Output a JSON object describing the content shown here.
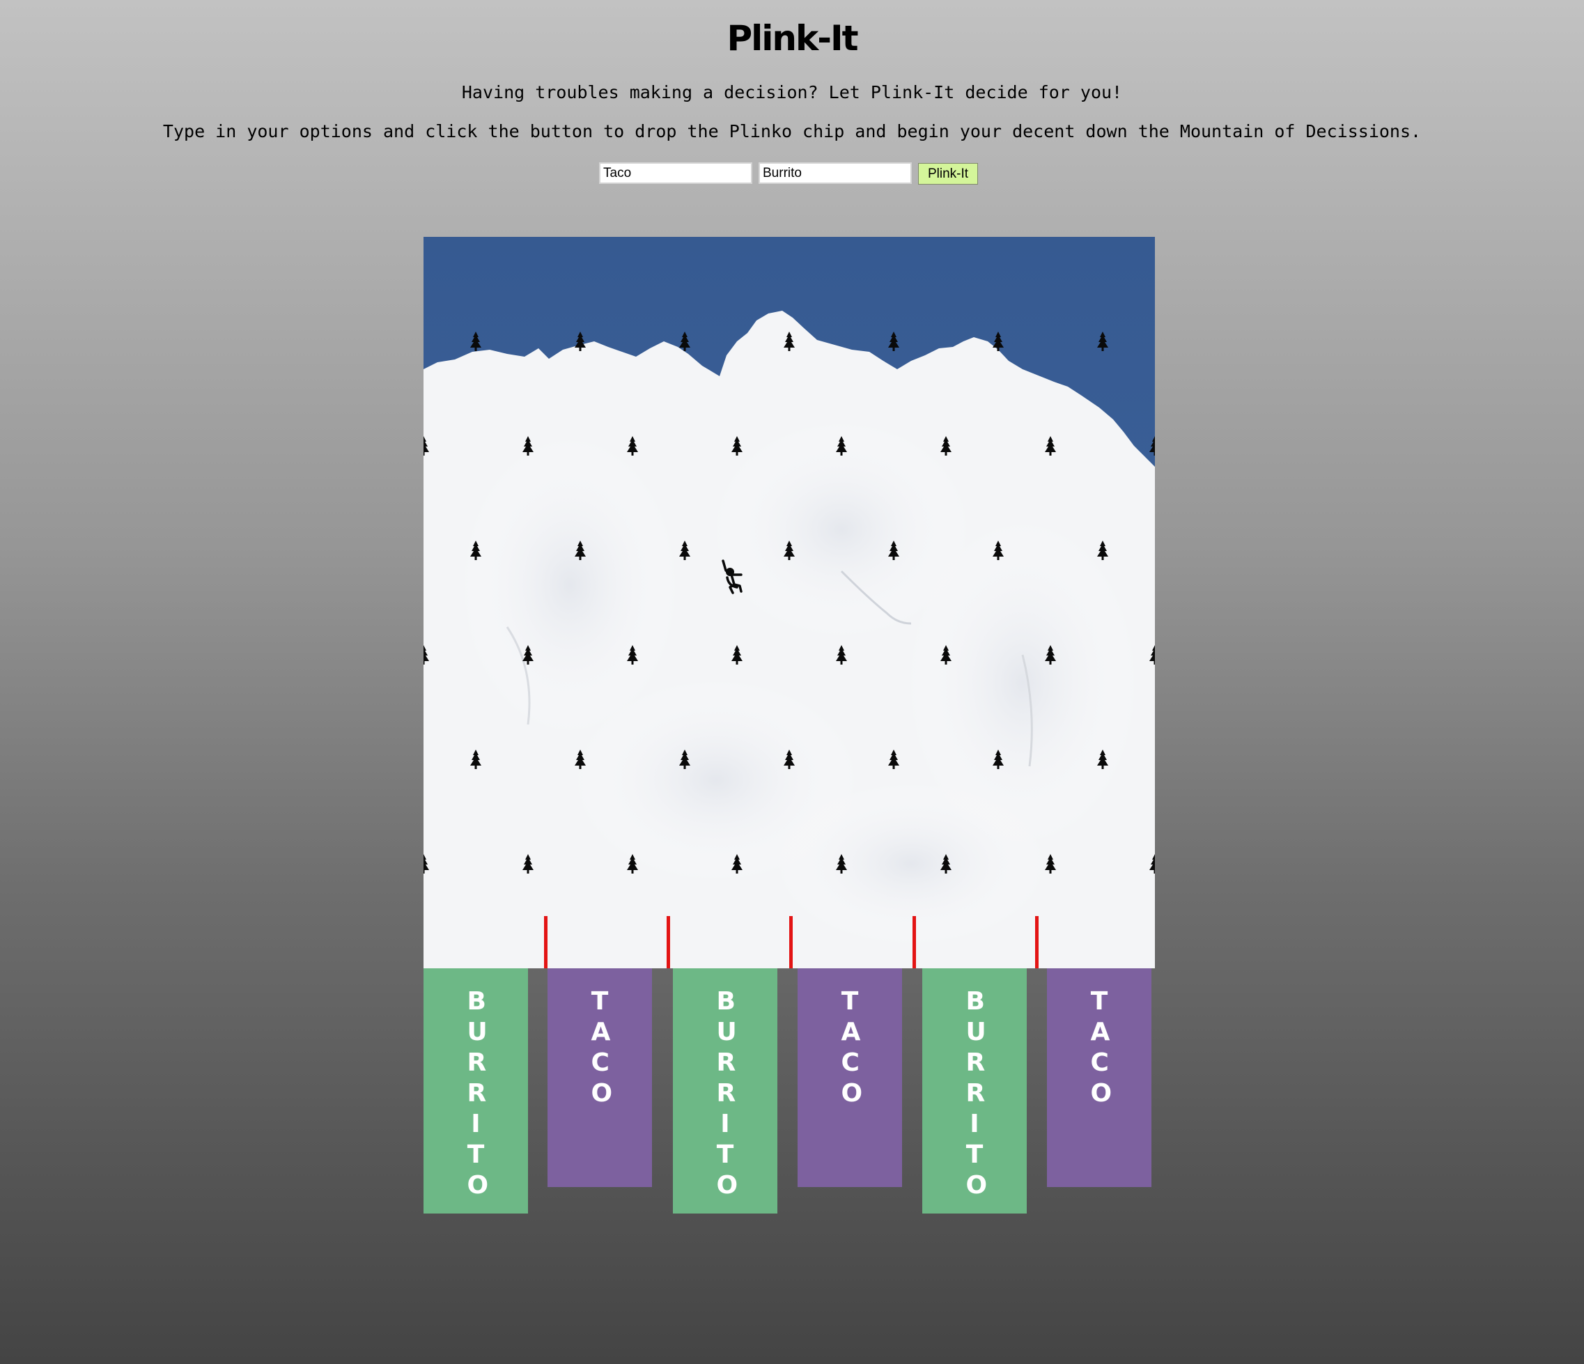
{
  "header": {
    "title": "Plink-It",
    "line1": "Having troubles making a decision? Let Plink-It decide for you!",
    "line2": "Type in your options and click the button to drop the Plinko chip and begin your decent down the Mountain of Decissions."
  },
  "controls": {
    "option1_value": "Taco",
    "option2_value": "Burrito",
    "button_label": "Plink-It"
  },
  "colors": {
    "burrito_bin": "#6db886",
    "taco_bin": "#7d619f",
    "divider": "#e31414",
    "sky": "#3b5e95",
    "button": "#d4f59a"
  },
  "icons": {
    "peg": "tree-icon",
    "chip": "skier-icon"
  },
  "bins": [
    {
      "label": "BURRITO",
      "type": "burrito"
    },
    {
      "label": "TACO",
      "type": "taco"
    },
    {
      "label": "BURRITO",
      "type": "burrito"
    },
    {
      "label": "TACO",
      "type": "taco"
    },
    {
      "label": "BURRITO",
      "type": "burrito"
    },
    {
      "label": "TACO",
      "type": "taco"
    }
  ]
}
